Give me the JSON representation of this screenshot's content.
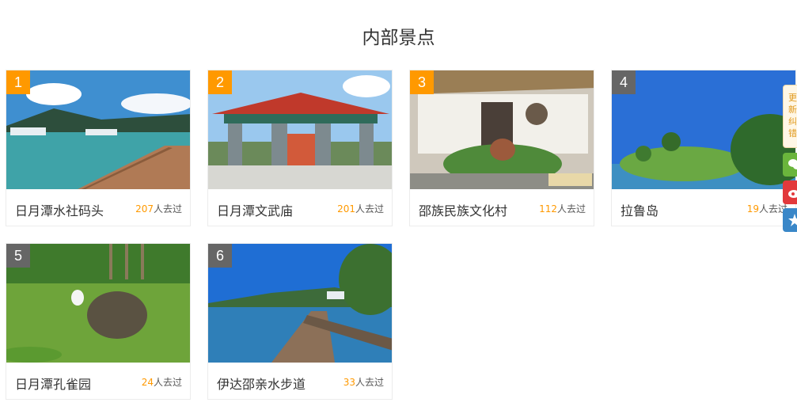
{
  "section_title": "内部景点",
  "visits_suffix": "人去过",
  "spots": [
    {
      "rank": "1",
      "name": "日月潭水社码头",
      "visits": "207"
    },
    {
      "rank": "2",
      "name": "日月潭文武庙",
      "visits": "201"
    },
    {
      "rank": "3",
      "name": "邵族民族文化村",
      "visits": "112"
    },
    {
      "rank": "4",
      "name": "拉鲁岛",
      "visits": "19"
    },
    {
      "rank": "5",
      "name": "日月潭孔雀园",
      "visits": "24"
    },
    {
      "rank": "6",
      "name": "伊达邵亲水步道",
      "visits": "33"
    }
  ],
  "side_tools": {
    "update_label": "更新纠错",
    "icons": [
      "wechat-icon",
      "weibo-icon",
      "favorite-icon"
    ]
  },
  "colors": {
    "accent": "#ff9900",
    "badge_gray": "#666666"
  }
}
